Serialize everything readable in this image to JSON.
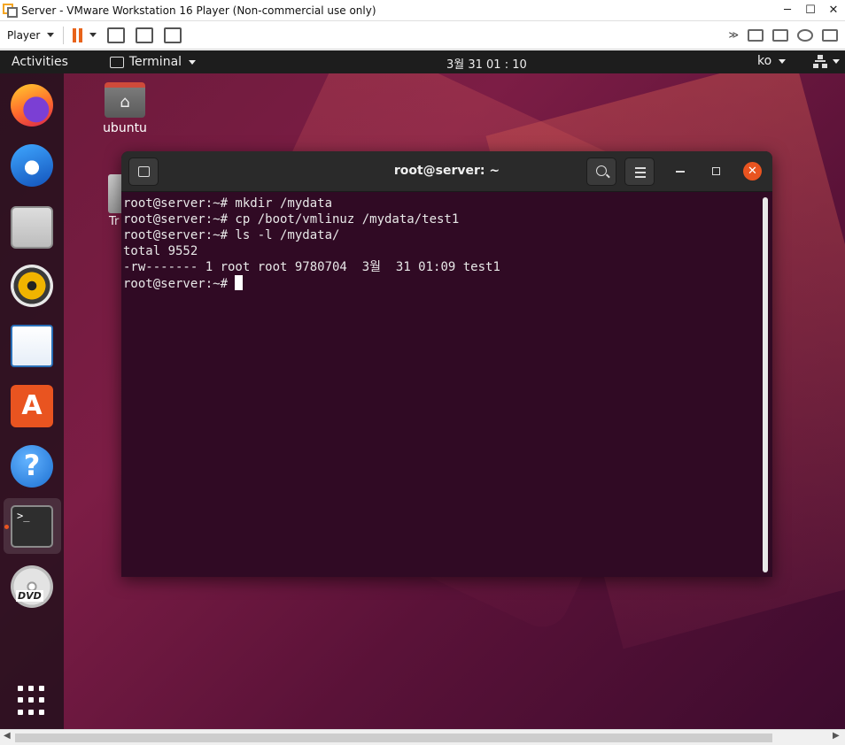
{
  "vmware": {
    "title": "Server - VMware Workstation 16 Player (Non-commercial use only)",
    "window_buttons": [
      "─",
      "☐",
      "✕"
    ],
    "toolbar": {
      "player_label": "Player",
      "more_label": "≫"
    }
  },
  "ubuntu": {
    "topbar": {
      "activities": "Activities",
      "app_name": "Terminal",
      "clock": "3월 31  01 : 10",
      "language": "ko"
    },
    "dock": {
      "items": [
        {
          "name": "Firefox"
        },
        {
          "name": "Thunderbird"
        },
        {
          "name": "Files"
        },
        {
          "name": "Rhythmbox"
        },
        {
          "name": "LibreOffice Writer"
        },
        {
          "name": "Ubuntu Software",
          "glyph": "A"
        },
        {
          "name": "Help",
          "glyph": "?"
        },
        {
          "name": "Terminal",
          "glyph": ">_",
          "active": true
        },
        {
          "name": "DVD",
          "glyph": "DVD"
        }
      ]
    },
    "desktop_icons": {
      "home_label": "ubuntu",
      "trash_label": "Tr"
    }
  },
  "terminal": {
    "title": "root@server: ~",
    "close_glyph": "✕",
    "lines": [
      "root@server:~# mkdir /mydata",
      "root@server:~# cp /boot/vmlinuz /mydata/test1",
      "root@server:~# ls -l /mydata/",
      "total 9552",
      "-rw------- 1 root root 9780704  3월  31 01:09 test1"
    ],
    "prompt": "root@server:~# "
  },
  "colors": {
    "terminal_bg": "#300a24",
    "ubuntu_orange": "#e95420",
    "topbar_bg": "#1d1d1d"
  }
}
